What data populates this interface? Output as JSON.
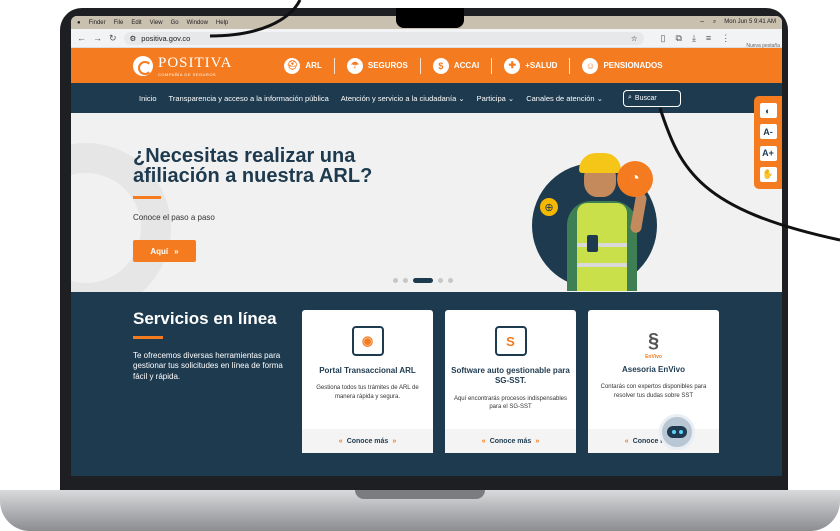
{
  "mac": {
    "menu": [
      "Finder",
      "File",
      "Edit",
      "View",
      "Go",
      "Window",
      "Help"
    ],
    "clock": "Mon Jun 5 9:41 AM"
  },
  "browser": {
    "url": "positiva.gov.co",
    "profile_note": "Nueva pestaña"
  },
  "header": {
    "logo": "POSITIVA",
    "logo_sub": "COMPAÑÍA DE SEGUROS",
    "nav": [
      {
        "label": "ARL",
        "icon": "helmet-icon"
      },
      {
        "label": "SEGUROS",
        "icon": "umbrella-icon"
      },
      {
        "label": "ACCAI",
        "icon": "dollar-icon"
      },
      {
        "label": "+SALUD",
        "icon": "shield-plus-icon"
      },
      {
        "label": "PENSIONADOS",
        "icon": "people-icon"
      }
    ]
  },
  "main_nav": {
    "links": [
      "Inicio",
      "Transparencia y acceso a la información pública",
      "Atención y servicio a la ciudadanía",
      "Participa",
      "Canales de atención"
    ],
    "search_label": "Buscar"
  },
  "hero": {
    "title": "¿Necesitas realizar una afiliación a nuestra ARL?",
    "subtitle": "Conoce el paso a paso",
    "button": "Aquí",
    "slides": 5,
    "active_slide": 3
  },
  "tools": [
    "◐",
    "A-",
    "A+",
    "✋"
  ],
  "services": {
    "title": "Servicios en línea",
    "description": "Te ofrecemos diversas herramientas para gestionar tus solicitudes en línea de forma fácil y rápida.",
    "cards": [
      {
        "title": "Portal Transaccional ARL",
        "text": "Gestiona todos tus trámites de ARL de manera rápida y segura.",
        "link": "Conoce más"
      },
      {
        "title": "Software auto gestionable para SG-SST.",
        "text": "Aquí encontrarás procesos indispensables para el SG-SST",
        "link": "Conoce más"
      },
      {
        "brand": "EnVivo",
        "title": "Asesoria EnVivo",
        "text": "Contarás con expertos disponibles para resolver tus dudas sobre SST",
        "link": "Conoce más"
      }
    ]
  },
  "colors": {
    "brand_orange": "#f47b20",
    "brand_navy": "#1e3a4f"
  }
}
